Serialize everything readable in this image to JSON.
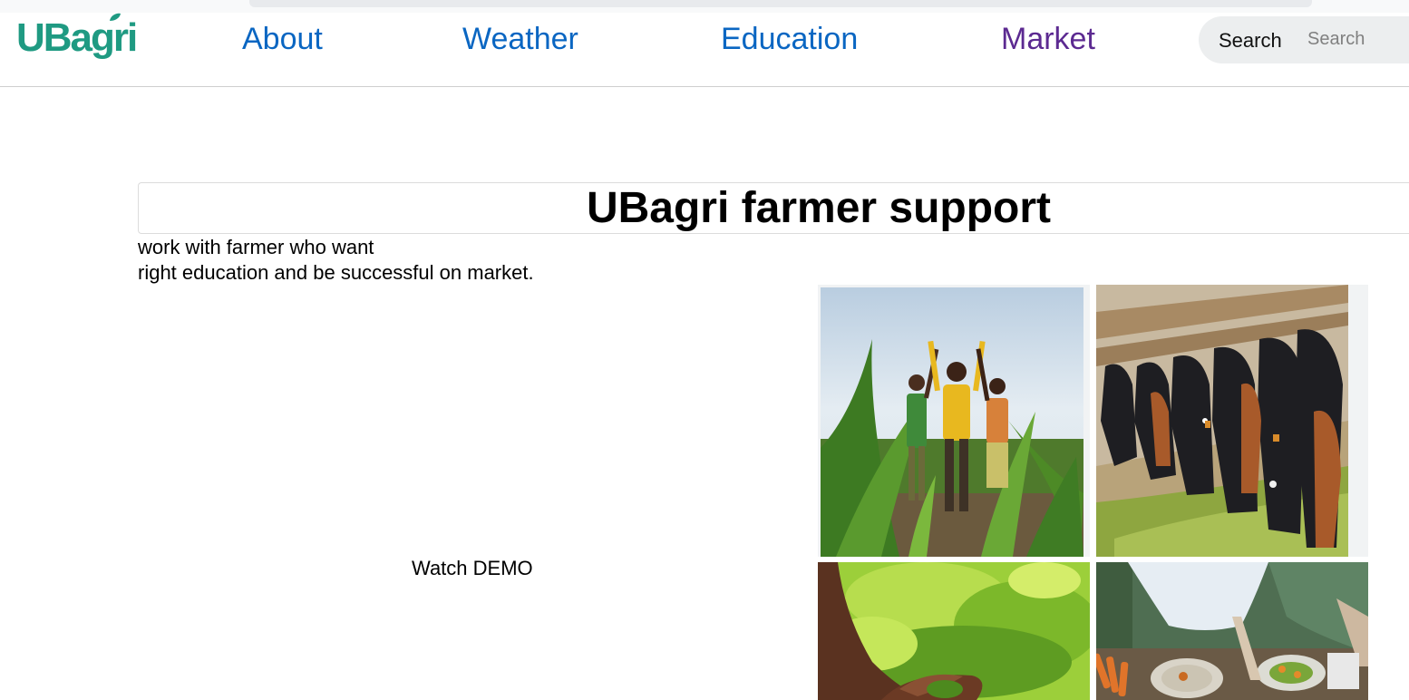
{
  "brand": {
    "name": "UBagri",
    "color": "#1f9a82"
  },
  "nav": {
    "items": [
      {
        "label": "About"
      },
      {
        "label": "Weather"
      },
      {
        "label": "Education"
      },
      {
        "label": "Market"
      }
    ],
    "link_color": "#0a66c2",
    "visited_color": "#5c2a91"
  },
  "search": {
    "label": "Search",
    "placeholder": "Search",
    "value": ""
  },
  "hero": {
    "title": "UBagri farmer support",
    "line1": "work with farmer who want",
    "line2": "right education and be successful on market.",
    "demo_label": "Watch DEMO"
  },
  "gallery": {
    "images": [
      {
        "icon": "farmers-in-maize-field-photo"
      },
      {
        "icon": "cattle-feeding-photo"
      },
      {
        "icon": "tea-leaves-harvest-photo"
      },
      {
        "icon": "food-preparation-photo"
      }
    ]
  }
}
